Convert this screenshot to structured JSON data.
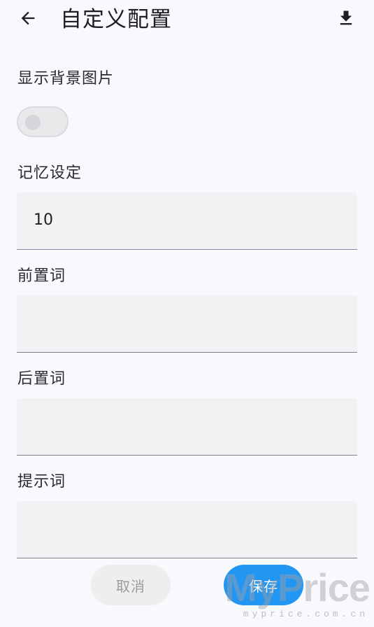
{
  "header": {
    "title": "自定义配置",
    "back_icon": "arrow-left-icon",
    "download_icon": "download-icon"
  },
  "settings": {
    "show_background": {
      "label": "显示背景图片",
      "enabled": false
    },
    "memory": {
      "label": "记忆设定",
      "value": "10"
    },
    "prefix": {
      "label": "前置词",
      "value": ""
    },
    "suffix": {
      "label": "后置词",
      "value": ""
    },
    "prompt": {
      "label": "提示词",
      "value": ""
    }
  },
  "actions": {
    "cancel_label": "取消",
    "save_label": "保存"
  },
  "watermark": {
    "brand": "MyPrice",
    "domain": "myprice.com.cn"
  },
  "colors": {
    "accent": "#2196f3",
    "background": "#f8f9fd",
    "field_bg": "#f2f2f4"
  }
}
